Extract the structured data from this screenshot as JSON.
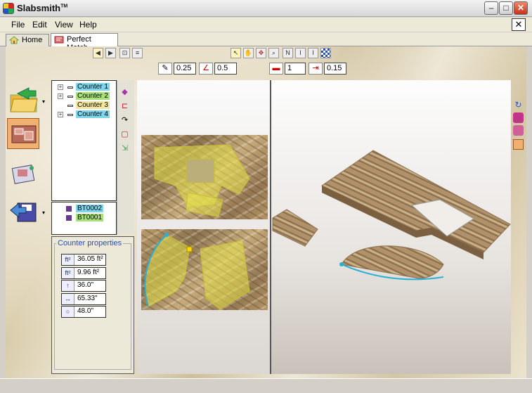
{
  "window": {
    "title": "Slabsmith",
    "title_mark": "TM",
    "minimize_symbol": "–",
    "maximize_symbol": "□",
    "close_symbol": "✕",
    "doc_close_symbol": "✕"
  },
  "menu": [
    "File",
    "Edit",
    "View",
    "Help"
  ],
  "tabs": [
    {
      "label": "Home",
      "icon": "house-icon",
      "active": false
    },
    {
      "label": "Perfect Match",
      "icon": "perfect-match-icon",
      "active": true
    }
  ],
  "toolbar_symbols": {
    "tree_plus": "+",
    "flip_n": "N",
    "flip_v": "I",
    "flip_t": "I",
    "prop_sqft": "ft²",
    "prop_height": "↑",
    "prop_length": "↔",
    "prop_angle": "○"
  },
  "params": {
    "offset_value": "0.25",
    "angle_value": "0.5",
    "count_value": "1",
    "spacing_value": "0.15"
  },
  "tree": {
    "counters": [
      {
        "label": "Counter 1",
        "highlight": "#7fd6ea",
        "expandable": true
      },
      {
        "label": "Counter 2",
        "highlight": "#a8e07a",
        "expandable": true
      },
      {
        "label": "Counter 3",
        "highlight": "#f2e6a0",
        "expandable": false
      },
      {
        "label": "Counter 4",
        "highlight": "#7fd6ea",
        "expandable": true
      }
    ],
    "slabs": [
      {
        "label": "BT0002",
        "highlight": "#7fd6ea"
      },
      {
        "label": "BT0001",
        "highlight": "#a8e07a"
      }
    ]
  },
  "properties": {
    "title": "Counter properties",
    "rows": [
      {
        "icon": "area-total-icon",
        "value": "36.05 ft²"
      },
      {
        "icon": "area-piece-icon",
        "value": "9.96 ft²"
      },
      {
        "icon": "height-icon",
        "value": "36.0\""
      },
      {
        "icon": "length-icon",
        "value": "65.33\""
      },
      {
        "icon": "angle-icon",
        "value": "48.0\""
      }
    ]
  },
  "colors": {
    "accent": "#2a4fb6",
    "selection_fill": "#e6e24a",
    "outline": "#2ab0d0"
  }
}
